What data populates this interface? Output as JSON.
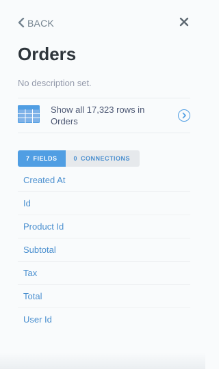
{
  "header": {
    "back_label": "BACK",
    "back_icon": "chevron-left-icon",
    "close_icon": "close-icon"
  },
  "entity": {
    "title": "Orders",
    "description": "No description set."
  },
  "rows_link": {
    "icon": "table-icon",
    "line1": "Show all 17,323 rows in",
    "line2": "Orders",
    "arrow_icon": "chevron-right-circle-icon"
  },
  "tabs": [
    {
      "count": "7",
      "label": "FIELDS",
      "active": true
    },
    {
      "count": "0",
      "label": "CONNECTIONS",
      "active": false
    }
  ],
  "fields": [
    {
      "label": "Created At"
    },
    {
      "label": "Id"
    },
    {
      "label": "Product Id"
    },
    {
      "label": "Subtotal"
    },
    {
      "label": "Tax"
    },
    {
      "label": "Total"
    },
    {
      "label": "User Id"
    }
  ],
  "colors": {
    "accent": "#509ee3",
    "link": "#4a8fcf",
    "text": "#2e353b",
    "muted": "#949aab",
    "background": "#f9fbfc"
  }
}
